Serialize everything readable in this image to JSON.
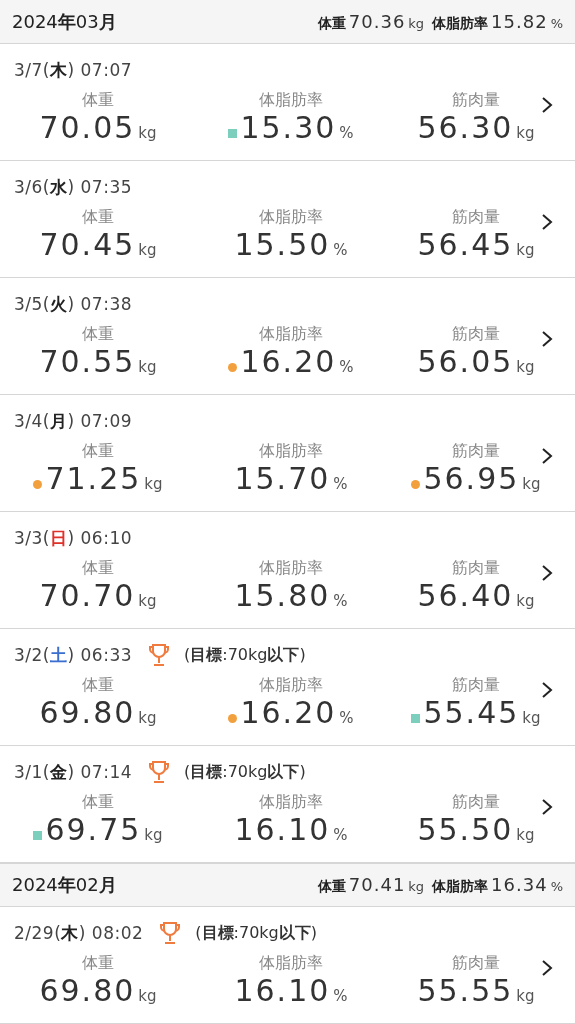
{
  "months": [
    {
      "title": "2024**年**03**月**",
      "summary": [
        {
          "label": "体重",
          "value": "70.36",
          "unit": "kg"
        },
        {
          "label": "体脂肪率",
          "value": "15.82",
          "unit": "%"
        }
      ],
      "entries": [
        {
          "datetime": "3/7(**木**) 07:07",
          "color": "#222222",
          "metrics": [
            {
              "kind": "plain",
              "label": "体重",
              "value": "70.05",
              "unit": "kg"
            },
            {
              "kind": "square",
              "color": "#7ccfbd",
              "label": "体脂肪率",
              "value": "15.30",
              "unit": "%"
            },
            {
              "kind": "plain",
              "label": "筋肉量",
              "value": "56.30",
              "unit": "kg"
            }
          ]
        },
        {
          "datetime": "3/6(**水**) 07:35",
          "color": "#222222",
          "metrics": [
            {
              "kind": "plain",
              "label": "体重",
              "value": "70.45",
              "unit": "kg"
            },
            {
              "kind": "plain",
              "label": "体脂肪率",
              "value": "15.50",
              "unit": "%"
            },
            {
              "kind": "plain",
              "label": "筋肉量",
              "value": "56.45",
              "unit": "kg"
            }
          ]
        },
        {
          "datetime": "3/5(**火**) 07:38",
          "color": "#222222",
          "metrics": [
            {
              "kind": "plain",
              "label": "体重",
              "value": "70.55",
              "unit": "kg"
            },
            {
              "kind": "dot",
              "color": "#f2a03d",
              "label": "体脂肪率",
              "value": "16.20",
              "unit": "%"
            },
            {
              "kind": "plain",
              "label": "筋肉量",
              "value": "56.05",
              "unit": "kg"
            }
          ]
        },
        {
          "datetime": "3/4(**月**) 07:09",
          "color": "#222222",
          "metrics": [
            {
              "kind": "dot",
              "color": "#f2a03d",
              "label": "体重",
              "value": "71.25",
              "unit": "kg"
            },
            {
              "kind": "plain",
              "label": "体脂肪率",
              "value": "15.70",
              "unit": "%"
            },
            {
              "kind": "dot",
              "color": "#f2a03d",
              "label": "筋肉量",
              "value": "56.95",
              "unit": "kg"
            }
          ]
        },
        {
          "datetime": "3/3(**日**) 06:10",
          "color": "#e0302a",
          "metrics": [
            {
              "kind": "plain",
              "label": "体重",
              "value": "70.70",
              "unit": "kg"
            },
            {
              "kind": "plain",
              "label": "体脂肪率",
              "value": "15.80",
              "unit": "%"
            },
            {
              "kind": "plain",
              "label": "筋肉量",
              "value": "56.40",
              "unit": "kg"
            }
          ]
        },
        {
          "datetime": "3/2(**土**) 06:33",
          "color": "#3a6fd0",
          "goal": "(**目標**:70kg**以下**)",
          "metrics": [
            {
              "kind": "plain",
              "label": "体重",
              "value": "69.80",
              "unit": "kg"
            },
            {
              "kind": "dot",
              "color": "#f2a03d",
              "label": "体脂肪率",
              "value": "16.20",
              "unit": "%"
            },
            {
              "kind": "square",
              "color": "#7ccfbd",
              "label": "筋肉量",
              "value": "55.45",
              "unit": "kg"
            }
          ]
        },
        {
          "datetime": "3/1(**金**) 07:14",
          "color": "#222222",
          "goal": "(**目標**:70kg**以下**)",
          "metrics": [
            {
              "kind": "square",
              "color": "#7ccfbd",
              "label": "体重",
              "value": "69.75",
              "unit": "kg"
            },
            {
              "kind": "plain",
              "label": "体脂肪率",
              "value": "16.10",
              "unit": "%"
            },
            {
              "kind": "plain",
              "label": "筋肉量",
              "value": "55.50",
              "unit": "kg"
            }
          ]
        }
      ]
    },
    {
      "title": "2024**年**02**月**",
      "summary": [
        {
          "label": "体重",
          "value": "70.41",
          "unit": "kg"
        },
        {
          "label": "体脂肪率",
          "value": "16.34",
          "unit": "%"
        }
      ],
      "entries": [
        {
          "datetime": "2/29(**木**) 08:02",
          "color": "#222222",
          "goal": "(**目標**:70kg**以下**)",
          "metrics": [
            {
              "kind": "plain",
              "label": "体重",
              "value": "69.80",
              "unit": "kg"
            },
            {
              "kind": "plain",
              "label": "体脂肪率",
              "value": "16.10",
              "unit": "%"
            },
            {
              "kind": "plain",
              "label": "筋肉量",
              "value": "55.55",
              "unit": "kg"
            }
          ]
        }
      ]
    }
  ]
}
